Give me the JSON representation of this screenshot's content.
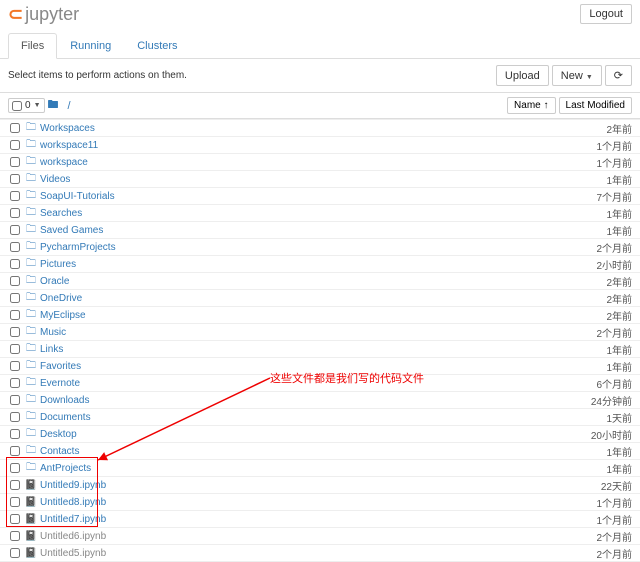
{
  "header": {
    "logo": "jupyter",
    "logout": "Logout"
  },
  "tabs": [
    {
      "label": "Files",
      "active": true
    },
    {
      "label": "Running",
      "active": false
    },
    {
      "label": "Clusters",
      "active": false
    }
  ],
  "toolbar": {
    "hint": "Select items to perform actions on them.",
    "upload": "Upload",
    "new": "New",
    "refresh": "⟳"
  },
  "cols": {
    "selcount": "0",
    "crumb": "/",
    "name": "Name",
    "arrow": "↑",
    "lastmod": "Last Modified"
  },
  "annotation": "这些文件都是我们写的代码文件",
  "rows": [
    {
      "t": "d",
      "n": "Workspaces",
      "m": "2年前"
    },
    {
      "t": "d",
      "n": "workspace11",
      "m": "1个月前"
    },
    {
      "t": "d",
      "n": "workspace",
      "m": "1个月前"
    },
    {
      "t": "d",
      "n": "Videos",
      "m": "1年前"
    },
    {
      "t": "d",
      "n": "SoapUI-Tutorials",
      "m": "7个月前"
    },
    {
      "t": "d",
      "n": "Searches",
      "m": "1年前"
    },
    {
      "t": "d",
      "n": "Saved Games",
      "m": "1年前"
    },
    {
      "t": "d",
      "n": "PycharmProjects",
      "m": "2个月前"
    },
    {
      "t": "d",
      "n": "Pictures",
      "m": "2小时前"
    },
    {
      "t": "d",
      "n": "Oracle",
      "m": "2年前"
    },
    {
      "t": "d",
      "n": "OneDrive",
      "m": "2年前"
    },
    {
      "t": "d",
      "n": "MyEclipse",
      "m": "2年前"
    },
    {
      "t": "d",
      "n": "Music",
      "m": "2个月前"
    },
    {
      "t": "d",
      "n": "Links",
      "m": "1年前"
    },
    {
      "t": "d",
      "n": "Favorites",
      "m": "1年前"
    },
    {
      "t": "d",
      "n": "Evernote",
      "m": "6个月前"
    },
    {
      "t": "d",
      "n": "Downloads",
      "m": "24分钟前"
    },
    {
      "t": "d",
      "n": "Documents",
      "m": "1天前"
    },
    {
      "t": "d",
      "n": "Desktop",
      "m": "20小时前"
    },
    {
      "t": "d",
      "n": "Contacts",
      "m": "1年前"
    },
    {
      "t": "d",
      "n": "AntProjects",
      "m": "1年前"
    },
    {
      "t": "nb",
      "n": "Untitled9.ipynb",
      "m": "22天前"
    },
    {
      "t": "nb",
      "n": "Untitled8.ipynb",
      "m": "1个月前"
    },
    {
      "t": "nb",
      "n": "Untitled7.ipynb",
      "m": "1个月前"
    },
    {
      "t": "nb",
      "n": "Untitled6.ipynb",
      "m": "2个月前"
    },
    {
      "t": "nb",
      "n": "Untitled5.ipynb",
      "m": "2个月前"
    }
  ]
}
